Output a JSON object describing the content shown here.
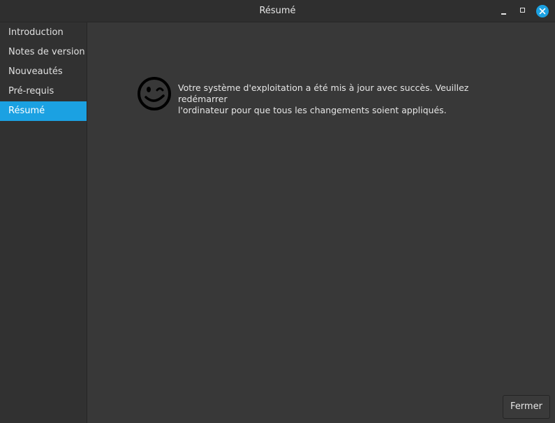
{
  "window": {
    "title": "Résumé"
  },
  "sidebar": {
    "items": [
      {
        "label": "Introduction",
        "selected": false
      },
      {
        "label": "Notes de version",
        "selected": false
      },
      {
        "label": "Nouveautés",
        "selected": false
      },
      {
        "label": "Pré-requis",
        "selected": false
      },
      {
        "label": "Résumé",
        "selected": true
      }
    ]
  },
  "main": {
    "icon": "wink-smiley-icon",
    "message_line1": "Votre système d'exploitation a été mis à jour avec succès. Veuillez redémarrer",
    "message_line2": "l'ordinateur pour que tous les changements soient appliqués."
  },
  "footer": {
    "close_label": "Fermer"
  },
  "colors": {
    "accent": "#1ba1e2",
    "background": "#383838",
    "sidebar": "#313131",
    "titlebar": "#2f2f2f",
    "text": "#e6e6e6"
  }
}
